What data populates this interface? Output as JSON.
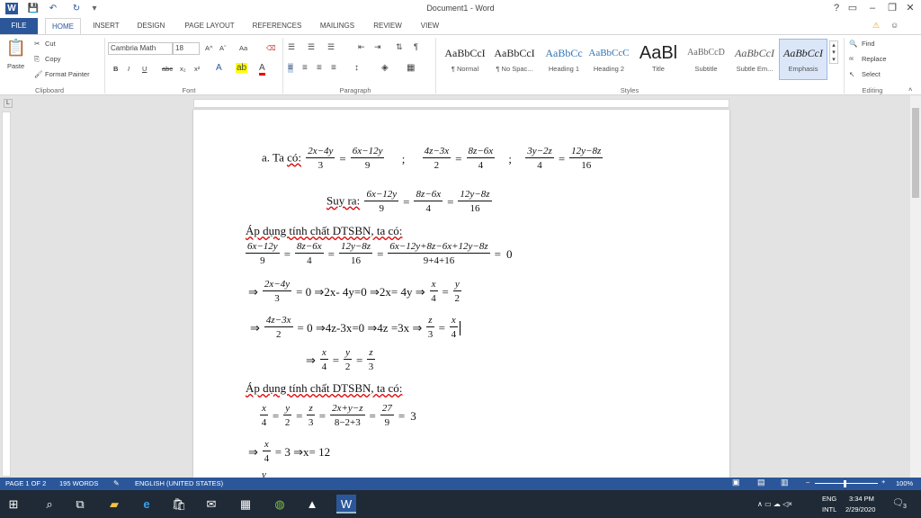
{
  "window": {
    "title": "Document1 - Word",
    "help": "?",
    "restore_ribbon": "▭",
    "minimize": "–",
    "maximize": "❐",
    "close": "✕"
  },
  "tabs": [
    "FILE",
    "HOME",
    "INSERT",
    "DESIGN",
    "PAGE LAYOUT",
    "REFERENCES",
    "MAILINGS",
    "REVIEW",
    "VIEW"
  ],
  "clipboard": {
    "paste": "Paste",
    "cut": "Cut",
    "copy": "Copy",
    "format_painter": "Format Painter",
    "group": "Clipboard"
  },
  "font": {
    "name": "Cambria Math",
    "size": "18",
    "group": "Font",
    "bold": "B",
    "italic": "I",
    "underline": "U",
    "strike": "abc",
    "sub": "x₂",
    "sup": "x²",
    "grow": "A^",
    "shrink": "Aˇ",
    "case": "Aa"
  },
  "paragraph": {
    "group": "Paragraph"
  },
  "styles": {
    "group": "Styles",
    "items": [
      {
        "sample": "AaBbCcI",
        "name": "¶ Normal"
      },
      {
        "sample": "AaBbCcI",
        "name": "¶ No Spac..."
      },
      {
        "sample": "AaBbCc",
        "name": "Heading 1"
      },
      {
        "sample": "AaBbCcC",
        "name": "Heading 2"
      },
      {
        "sample": "AaBl",
        "name": "Title"
      },
      {
        "sample": "AaBbCcD",
        "name": "Subtitle"
      },
      {
        "sample": "AaBbCcI",
        "name": "Subtle Em..."
      },
      {
        "sample": "AaBbCcI",
        "name": "Emphasis"
      }
    ]
  },
  "editing": {
    "find": "Find",
    "replace": "Replace",
    "select": "Select",
    "group": "Editing"
  },
  "doc": {
    "l1_prefix": "a. Ta",
    "l1_co": "có:",
    "f1n": "2x−4y",
    "f1d": "3",
    "f2n": "6x−12y",
    "f2d": "9",
    "f3n": "4z−3x",
    "f3d": "2",
    "f4n": "8z−6x",
    "f4d": "4",
    "f5n": "3y−2z",
    "f5d": "4",
    "f6n": "12y−8z",
    "f6d": "16",
    "semi": ";",
    "suyra": "Suy ra:",
    "s1n": "6x−12y",
    "s1d": "9",
    "s2n": "8z−6x",
    "s2d": "4",
    "s3n": "12y−8z",
    "s3d": "16",
    "ap1": "Áp dụng tính chất DTSBN, ta có:",
    "a1n": "6x−12y",
    "a1d": "9",
    "a2n": "8z−6x",
    "a2d": "4",
    "a3n": "12y−8z",
    "a3d": "16",
    "a4n": "6x−12y+8z−6x+12y−8z",
    "a4d": "9+4+16",
    "zero": "0",
    "r1_pre": "⇒",
    "r1n": "2x−4y",
    "r1d": "3",
    "r1_mid": "= 0 ⇒2x- 4y=0 ⇒2x= 4y ⇒",
    "r1xn": "x",
    "r1xd": "4",
    "r1yn": "y",
    "r1yd": "2",
    "r2_pre": "⇒",
    "r2n": "4z−3x",
    "r2d": "2",
    "r2_mid": "= 0 ⇒4z-3x=0 ⇒4z =3x ⇒",
    "r2zn": "z",
    "r2zd": "3",
    "r2xn": "x",
    "r2xd": "4",
    "r3_pre": "⇒",
    "r3an": "x",
    "r3ad": "4",
    "r3bn": "y",
    "r3bd": "2",
    "r3cn": "z",
    "r3cd": "3",
    "ap2": "Áp dụng tính chất DTSBN, ta có:",
    "b1n": "x",
    "b1d": "4",
    "b2n": "y",
    "b2d": "2",
    "b3n": "z",
    "b3d": "3",
    "b4n": "2x+y−z",
    "b4d": "8−2+3",
    "b5n": "27",
    "b5d": "9",
    "three": "3",
    "r4_pre": "⇒",
    "r4n": "x",
    "r4d": "4",
    "r4_mid": "= 3 ⇒x= 12",
    "cut_line": "y"
  },
  "status": {
    "page": "PAGE 1 OF 2",
    "words": "195 WORDS",
    "lang": "ENGLISH (UNITED STATES)",
    "zoom": "100%"
  },
  "taskbar": {
    "lang1": "ENG",
    "lang2": "INTL",
    "time": "3:34 PM",
    "date": "2/29/2020",
    "notif": "3"
  }
}
